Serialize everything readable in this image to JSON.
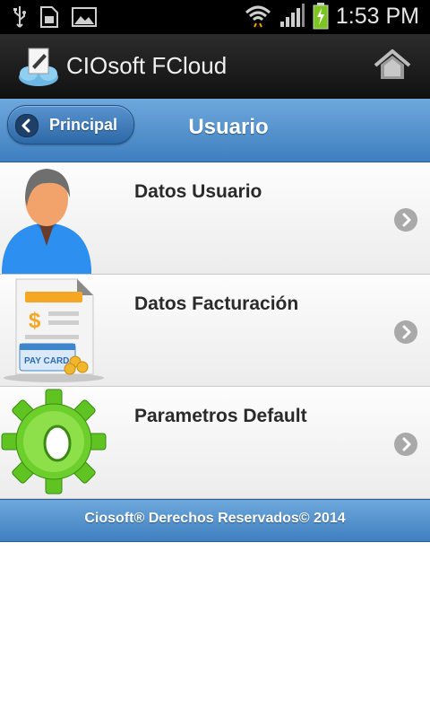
{
  "status_bar": {
    "time": "1:53 PM",
    "icons": [
      "usb-icon",
      "sim-icon",
      "image-icon",
      "wifi-icon",
      "signal-icon",
      "battery-charging-icon"
    ]
  },
  "action_bar": {
    "app_title": "CIOsoft FCloud",
    "logo_icon": "cloud-pencil-icon",
    "home_icon": "home-icon"
  },
  "header": {
    "back_label": "Principal",
    "title": "Usuario"
  },
  "menu": {
    "items": [
      {
        "label": "Datos Usuario",
        "icon": "user-avatar-icon"
      },
      {
        "label": "Datos Facturación",
        "icon": "billing-invoice-icon",
        "icon_text": "PAY CARD"
      },
      {
        "label": "Parametros Default",
        "icon": "green-gear-icon"
      }
    ]
  },
  "footer": {
    "text": "Ciosoft® Derechos Reservados© 2014"
  },
  "colors": {
    "header_blue": "#4f8fcd",
    "action_bar": "#1a1a1a",
    "status_bar": "#000000",
    "gear_green": "#6ccf2b"
  }
}
